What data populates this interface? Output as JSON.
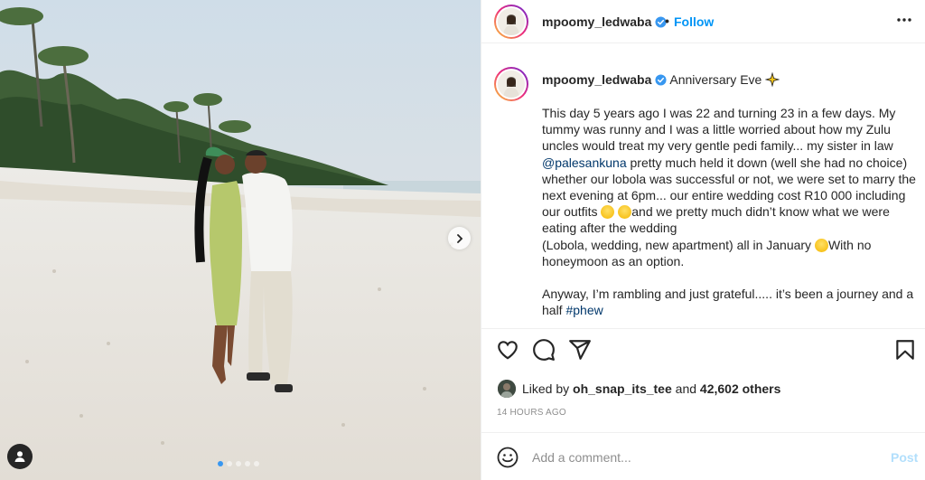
{
  "post": {
    "username": "mpoomy_ledwaba",
    "follow_label": "Follow",
    "separator": "•",
    "more_label": "•••",
    "caption_title": "Anniversary Eve",
    "caption_para1_a": "This day 5 years ago I was 22 and turning 23 in a few days. My tummy was runny and I was a little worried about how my Zulu uncles would treat my very gentle pedi family... my sister in law ",
    "caption_mention": "@palesankuna",
    "caption_para1_b": " pretty much held it down (well she had no choice) whether our lobola was successful or not, we were set to marry the next evening at 6pm... our entire wedding cost R10 000 including our outfits ",
    "caption_para1_c": "and we pretty much didn’t know what we were eating after the wedding\n(Lobola, wedding, new apartment) all in January ",
    "caption_para1_d": "With no honeymoon as an option.",
    "caption_para2": "Anyway, I’m rambling and just grateful..... it’s been a journey and a half ",
    "caption_hashtag": "#phew",
    "liked_prefix": "Liked by ",
    "liked_user": "oh_snap_its_tee",
    "liked_and": " and ",
    "liked_count": "42,602 others",
    "timestamp": "14 HOURS AGO",
    "comment_placeholder": "Add a comment...",
    "post_label": "Post"
  },
  "carousel": {
    "total": 5,
    "active": 0
  },
  "icons": {
    "verified": "verified-badge-icon",
    "like": "heart-icon",
    "comment": "comment-bubble-icon",
    "share": "paper-plane-icon",
    "save": "bookmark-icon",
    "emoji": "smiley-icon",
    "next": "chevron-right-icon",
    "tag": "user-tag-icon"
  },
  "colors": {
    "accent": "#0095f6",
    "verified": "#3897f0",
    "link": "#00376b",
    "muted": "#8e8e8e",
    "post_disabled": "#b2dffc"
  }
}
